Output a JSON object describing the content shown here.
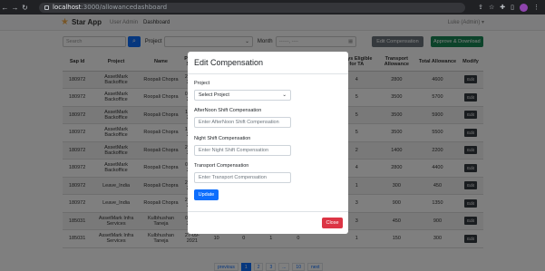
{
  "browser": {
    "url_host": "localhost",
    "url_path": ":3000/allowancedashboard"
  },
  "navbar": {
    "brand": "Star App",
    "links": [
      "User Admin",
      "Dashboard"
    ],
    "user": "Luke (Admin) ▾"
  },
  "filters": {
    "search_placeholder": "Search",
    "project_label": "Project",
    "month_label": "Month",
    "month_placeholder": "------, ----",
    "edit_compensation": "Edit Compensation",
    "approve_download": "Approve & Download"
  },
  "table": {
    "headers": [
      "Sap Id",
      "Project",
      "Name",
      "Period Start",
      "",
      "",
      "",
      "",
      "",
      "Days Eligible for TA",
      "Transport Allowance",
      "Total Allowance",
      "Modify"
    ],
    "rows": [
      {
        "sap": "180972",
        "project": "AssetMark Backoffice",
        "name": "Roopali Chopra",
        "period": "27-09-2021",
        "c5": "",
        "c6": "",
        "c7": "",
        "c8": "",
        "c9": "",
        "days": "4",
        "transport": "2800",
        "total": "4600",
        "edit": "Edit"
      },
      {
        "sap": "180972",
        "project": "AssetMark Backoffice",
        "name": "Roopali Chopra",
        "period": "04-10-2021",
        "c5": "",
        "c6": "",
        "c7": "",
        "c8": "",
        "c9": "",
        "days": "5",
        "transport": "3500",
        "total": "5700",
        "edit": "Edit"
      },
      {
        "sap": "180972",
        "project": "AssetMark Backoffice",
        "name": "Roopali Chopra",
        "period": "11-10-2021",
        "c5": "",
        "c6": "",
        "c7": "",
        "c8": "",
        "c9": "",
        "days": "5",
        "transport": "3500",
        "total": "5900",
        "edit": "Edit"
      },
      {
        "sap": "180972",
        "project": "AssetMark Backoffice",
        "name": "Roopali Chopra",
        "period": "18-10-2021",
        "c5": "",
        "c6": "",
        "c7": "",
        "c8": "",
        "c9": "",
        "days": "5",
        "transport": "3500",
        "total": "5500",
        "edit": "Edit"
      },
      {
        "sap": "180972",
        "project": "AssetMark Backoffice",
        "name": "Roopali Chopra",
        "period": "25-10-2021",
        "c5": "",
        "c6": "",
        "c7": "",
        "c8": "",
        "c9": "",
        "days": "2",
        "transport": "1400",
        "total": "2200",
        "edit": "Edit"
      },
      {
        "sap": "180972",
        "project": "AssetMark Backoffice",
        "name": "Roopali Chopra",
        "period": "01-11-2021",
        "c5": "",
        "c6": "",
        "c7": "",
        "c8": "",
        "c9": "",
        "days": "4",
        "transport": "2800",
        "total": "4400",
        "edit": "Edit"
      },
      {
        "sap": "180972",
        "project": "Leave_India",
        "name": "Roopali Chopra",
        "period": "27-09-2021",
        "c5": "",
        "c6": "",
        "c7": "",
        "c8": "",
        "c9": "",
        "days": "1",
        "transport": "300",
        "total": "450",
        "edit": "Edit"
      },
      {
        "sap": "180972",
        "project": "Leave_India",
        "name": "Roopali Chopra",
        "period": "25-10-2021",
        "c5": "",
        "c6": "",
        "c7": "",
        "c8": "",
        "c9": "",
        "days": "3",
        "transport": "900",
        "total": "1350",
        "edit": "Edit"
      },
      {
        "sap": "185031",
        "project": "AssetMark Infra Services",
        "name": "Kulbhushan Taneja",
        "period": "01-11-2021",
        "c5": "",
        "c6": "",
        "c7": "",
        "c8": "",
        "c9": "",
        "days": "3",
        "transport": "450",
        "total": "900",
        "edit": "Edit"
      },
      {
        "sap": "185031",
        "project": "AssetMark Infra Services",
        "name": "Kulbhushan Taneja",
        "period": "27-09-2021",
        "c5": "10",
        "c6": "0",
        "c7": "1",
        "c8": "0",
        "c9": "",
        "days": "1",
        "transport": "150",
        "total": "300",
        "edit": "Edit"
      }
    ],
    "last_row_end": "03-10-2021"
  },
  "pagination": {
    "items": [
      "previous",
      "1",
      "2",
      "3",
      "...",
      "10",
      "next"
    ]
  },
  "modal": {
    "title": "Edit Compensation",
    "project_label": "Project",
    "project_select": "Select Project",
    "afternoon_label": "AfterNoon Shift Compensation",
    "afternoon_placeholder": "Enter AfterNoon Shift Compensation",
    "night_label": "Night Shift Compensation",
    "night_placeholder": "Enter Night Shift Compensation",
    "transport_label": "Transport Compensation",
    "transport_placeholder": "Enter Transport Compensation",
    "update": "Update",
    "close": "Close"
  }
}
